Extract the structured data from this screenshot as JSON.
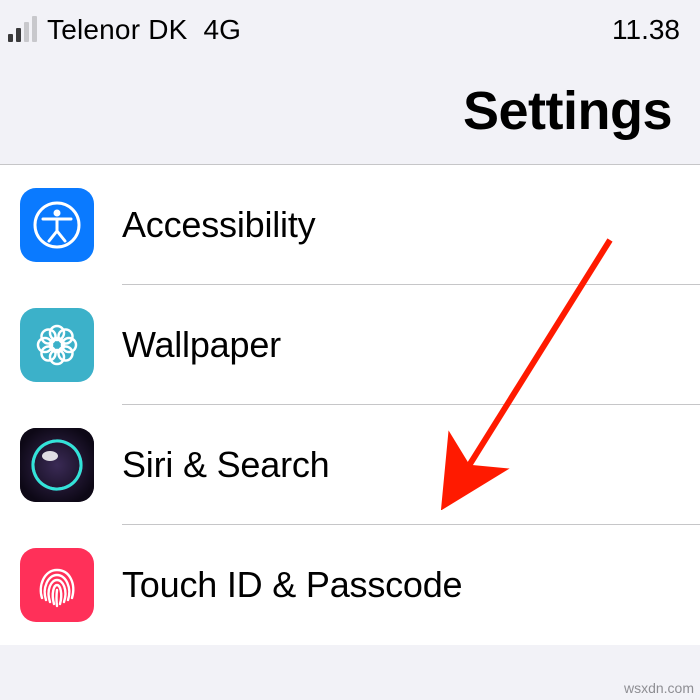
{
  "status": {
    "carrier": "Telenor DK",
    "network": "4G",
    "time": "11.38"
  },
  "header": {
    "title": "Settings"
  },
  "rows": [
    {
      "label": "Accessibility"
    },
    {
      "label": "Wallpaper"
    },
    {
      "label": "Siri & Search"
    },
    {
      "label": "Touch ID & Passcode"
    }
  ],
  "watermark": "wsxdn.com"
}
